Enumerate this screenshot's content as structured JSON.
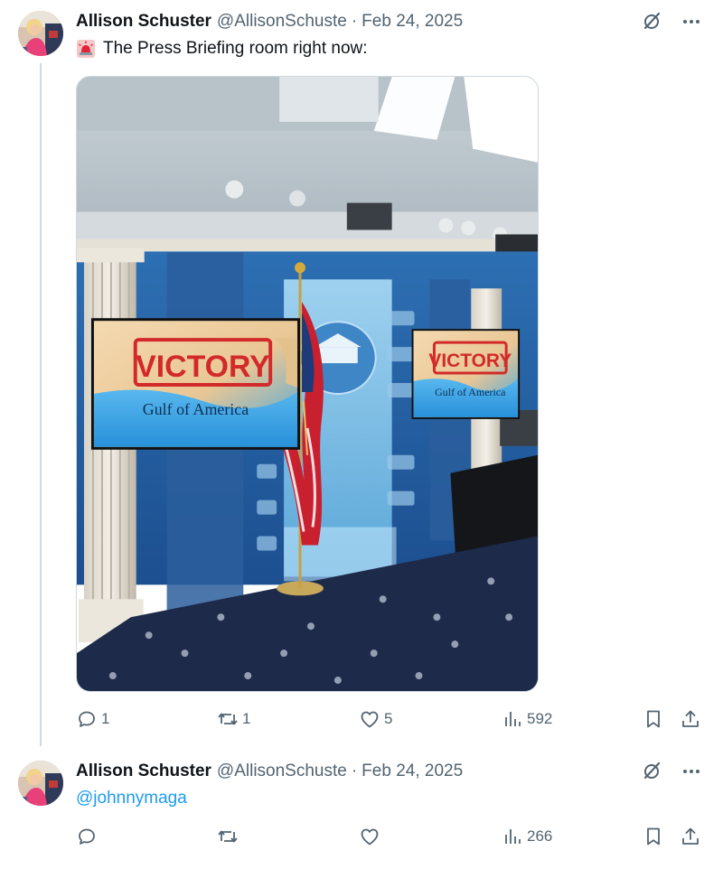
{
  "tweets": [
    {
      "author": {
        "name": "Allison Schuster",
        "handle": "@AllisonSchuste",
        "separator": "·",
        "date": "Feb 24, 2025"
      },
      "text": "The Press Briefing room right now:",
      "media": {
        "sign_left": {
          "headline": "VICTORY",
          "subline": "Gulf of America"
        },
        "sign_right": {
          "headline": "VICTORY",
          "subline": "Gulf of America"
        }
      },
      "stats": {
        "replies": "1",
        "reposts": "1",
        "likes": "5",
        "views": "592"
      }
    },
    {
      "author": {
        "name": "Allison Schuster",
        "handle": "@AllisonSchuste",
        "separator": "·",
        "date": "Feb 24, 2025"
      },
      "text": "@johnnymaga",
      "stats": {
        "replies": "",
        "reposts": "",
        "likes": "",
        "views": "266"
      }
    }
  ],
  "icons": {
    "siren": "rotating-light-icon",
    "grok": "grok-icon",
    "more": "more-icon",
    "reply": "reply-icon",
    "repost": "repost-icon",
    "like": "like-icon",
    "views": "views-icon",
    "bookmark": "bookmark-icon",
    "share": "share-icon"
  },
  "colors": {
    "text_primary": "#0f1419",
    "text_secondary": "#536471",
    "link": "#1d9bf0",
    "divider": "#cfd9de"
  }
}
